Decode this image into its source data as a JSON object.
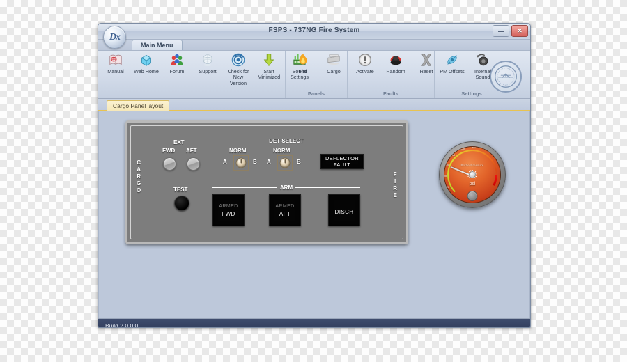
{
  "window": {
    "title": "FSPS - 737NG Fire System",
    "logo_text": "Dx",
    "minimize_label": "Minimize",
    "close_label": "Close"
  },
  "ribbon": {
    "tab": "Main Menu",
    "groups": [
      {
        "name": "",
        "items": [
          {
            "label": "Manual",
            "icon": "manual-icon"
          },
          {
            "label": "Web Home",
            "icon": "web-home-icon"
          },
          {
            "label": "Forum",
            "icon": "forum-icon"
          },
          {
            "label": "Support",
            "icon": "support-icon"
          },
          {
            "label": "Check for\nNew Version",
            "icon": "check-version-icon"
          },
          {
            "label": "Start\nMinimized",
            "icon": "start-minimized-icon"
          },
          {
            "label": "Sound\nSettings",
            "icon": "sound-settings-icon"
          }
        ]
      },
      {
        "name": "Panels",
        "items": [
          {
            "label": "Fire",
            "icon": "fire-icon"
          },
          {
            "label": "Cargo",
            "icon": "cargo-icon"
          }
        ]
      },
      {
        "name": "Faults",
        "items": [
          {
            "label": "Activate",
            "icon": "activate-icon"
          },
          {
            "label": "Random",
            "icon": "random-icon"
          },
          {
            "label": "Reset",
            "icon": "reset-icon"
          }
        ]
      },
      {
        "name": "Settings",
        "items": [
          {
            "label": "PM Offsets",
            "icon": "pm-offsets-icon"
          },
          {
            "label": "Internal\nSound",
            "icon": "internal-sound-icon"
          }
        ]
      }
    ],
    "seal_label": "Flight Simulation Platinum Developer"
  },
  "doc_tabs": [
    {
      "label": "Cargo Panel layout",
      "active": true
    }
  ],
  "cargo_panel": {
    "left_side_label": "C\nA\nR\nG\nO",
    "right_side_label": "F\nI\nR\nE",
    "ext_title": "EXT",
    "ext_lights": [
      {
        "label": "FWD"
      },
      {
        "label": "AFT"
      }
    ],
    "test_label": "TEST",
    "det_select_title": "DET SELECT",
    "arm_title": "ARM",
    "det_switches": [
      {
        "position_label": "NORM",
        "left_label": "A",
        "right_label": "B"
      },
      {
        "position_label": "NORM",
        "left_label": "A",
        "right_label": "B"
      }
    ],
    "deflector_fault": {
      "line1": "DEFLECTOR",
      "line2": "FAULT"
    },
    "arm_buttons": [
      {
        "top": "ARMED",
        "bottom": "FWD"
      },
      {
        "top": "ARMED",
        "bottom": "AFT"
      }
    ],
    "disch_button": {
      "top": "",
      "bottom": "DISCH"
    }
  },
  "gauge": {
    "title": "Bottle Pressure",
    "unit": "psi",
    "tick_labels": [
      "100",
      "150",
      "200",
      "250",
      "300",
      "350",
      "400",
      "450",
      "500",
      "550",
      "600",
      "650",
      "700"
    ],
    "needle_value": "250",
    "min": "100",
    "max": "700",
    "redline_start": "600",
    "colors": {
      "face": "#e2642a",
      "scale_green": "#b8d629",
      "scale_red": "#ee1111",
      "bezel": "#9a9a9a"
    }
  },
  "status_bar": {
    "text": "Build 2.0.0.0"
  },
  "theme": {
    "window_bg": "#bcc7d9",
    "ribbon_bg": "#d2dbe9",
    "canvas_bg": "#bdc8da",
    "panel_face": "#7d7d7d",
    "accent_yellow": "#e8c351",
    "status_bg": "#2e3a57"
  }
}
